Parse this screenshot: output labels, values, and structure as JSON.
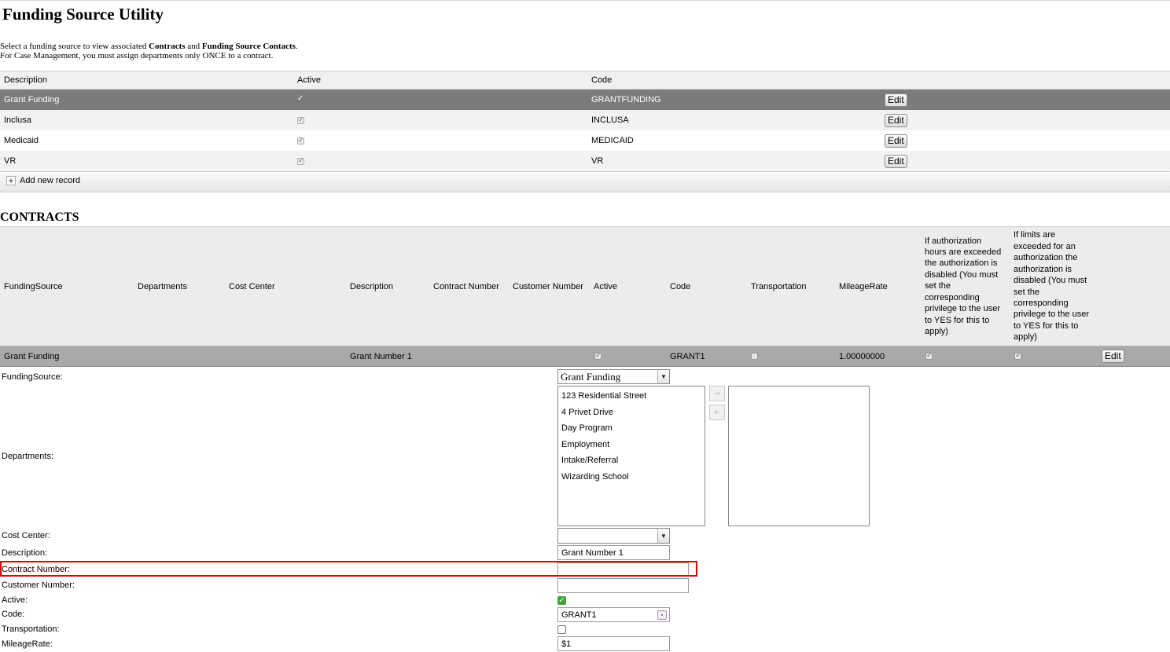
{
  "page": {
    "title": "Funding Source Utility",
    "intro_1_a": "Select a funding source to view associated ",
    "intro_1_b": "Contracts",
    "intro_1_c": " and ",
    "intro_1_d": "Funding Source Contacts",
    "intro_1_e": ".",
    "intro_2": "For Case Management, you must assign departments only ONCE to a contract."
  },
  "funding_grid": {
    "headers": {
      "description": "Description",
      "active": "Active",
      "code": "Code"
    },
    "rows": [
      {
        "description": "Grant Funding",
        "code": "GRANTFUNDING",
        "edit": "Edit"
      },
      {
        "description": "Inclusa",
        "code": "INCLUSA",
        "edit": "Edit"
      },
      {
        "description": "Medicaid",
        "code": "MEDICAID",
        "edit": "Edit"
      },
      {
        "description": "VR",
        "code": "VR",
        "edit": "Edit"
      }
    ],
    "add_new": "Add new record"
  },
  "contracts": {
    "title": "CONTRACTS",
    "headers": {
      "funding_source": "FundingSource",
      "departments": "Departments",
      "cost_center": "Cost Center",
      "description": "Description",
      "contract_number": "Contract Number",
      "customer_number": "Customer Number",
      "active": "Active",
      "code": "Code",
      "transportation": "Transportation",
      "mileage_rate": "MileageRate",
      "auth_hours": "If authorization hours are exceeded the authorization is disabled (You must set the corresponding privilege to the user to YES for this to apply)",
      "limits": "If limits are exceeded for an authorization the authorization is disabled (You must set the corresponding privilege to the user to YES for this to apply)"
    },
    "row": {
      "funding_source": "Grant Funding",
      "description": "Grant Number 1",
      "code": "GRANT1",
      "mileage_rate": "1.00000000",
      "edit": "Edit"
    }
  },
  "form": {
    "labels": {
      "funding_source": "FundingSource:",
      "departments": "Departments:",
      "cost_center": "Cost Center:",
      "description": "Description:",
      "contract_number": "Contract Number:",
      "customer_number": "Customer Number:",
      "active": "Active:",
      "code": "Code:",
      "transportation": "Transportation:",
      "mileage_rate": "MileageRate:"
    },
    "funding_source_value": "Grant Funding",
    "departments_available": [
      "123 Residential Street",
      "4 Privet Drive",
      "Day Program",
      "Employment",
      "Intake/Referral",
      "Wizarding School"
    ],
    "cost_center_value": "",
    "description_value": "Grant Number 1",
    "contract_number_value": "",
    "customer_number_value": "",
    "code_value": "GRANT1",
    "mileage_rate_value": "$1"
  }
}
